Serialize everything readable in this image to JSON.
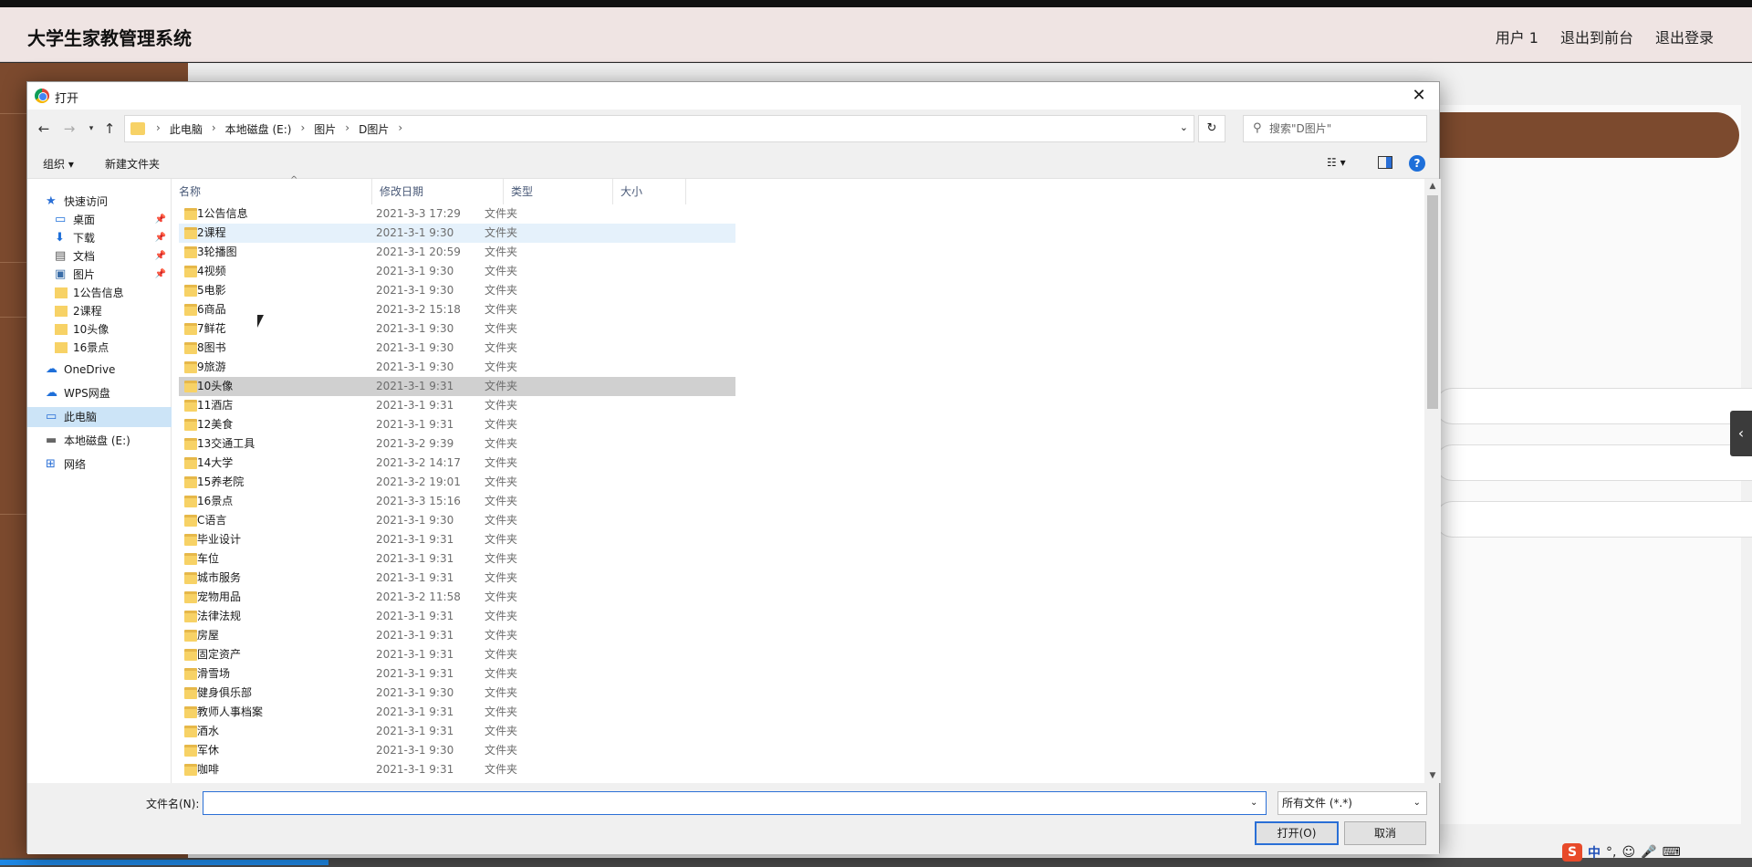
{
  "app": {
    "title": "大学生家教管理系统",
    "nav": [
      "用户 1",
      "退出到前台",
      "退出登录"
    ]
  },
  "dialog": {
    "title": "打开",
    "breadcrumb": [
      "此电脑",
      "本地磁盘 (E:)",
      "图片",
      "D图片"
    ],
    "search_placeholder": "搜索\"D图片\"",
    "toolbar": {
      "organize": "组织 ▾",
      "new_folder": "新建文件夹"
    },
    "nav_pane": [
      {
        "label": "快速访问",
        "icon": "star-icon",
        "pinned": false
      },
      {
        "label": "桌面",
        "icon": "desktop-icon",
        "pinned": true
      },
      {
        "label": "下载",
        "icon": "download-icon",
        "pinned": true
      },
      {
        "label": "文档",
        "icon": "document-icon",
        "pinned": true
      },
      {
        "label": "图片",
        "icon": "pictures-icon",
        "pinned": true
      },
      {
        "label": "1公告信息",
        "icon": "folder-icon",
        "pinned": false
      },
      {
        "label": "2课程",
        "icon": "folder-icon",
        "pinned": false
      },
      {
        "label": "10头像",
        "icon": "folder-icon",
        "pinned": false
      },
      {
        "label": "16景点",
        "icon": "folder-icon",
        "pinned": false
      },
      {
        "label": "OneDrive",
        "icon": "cloud-icon",
        "pinned": false
      },
      {
        "label": "WPS网盘",
        "icon": "cloud-icon",
        "pinned": false
      },
      {
        "label": "此电脑",
        "icon": "computer-icon",
        "pinned": false
      },
      {
        "label": "本地磁盘 (E:)",
        "icon": "drive-icon",
        "pinned": false
      },
      {
        "label": "网络",
        "icon": "network-icon",
        "pinned": false
      }
    ],
    "columns": [
      "名称",
      "修改日期",
      "类型",
      "大小"
    ],
    "files": [
      {
        "name": "1公告信息",
        "date": "2021-3-3 17:29",
        "type": "文件夹"
      },
      {
        "name": "2课程",
        "date": "2021-3-1 9:30",
        "type": "文件夹"
      },
      {
        "name": "3轮播图",
        "date": "2021-3-1 20:59",
        "type": "文件夹"
      },
      {
        "name": "4视频",
        "date": "2021-3-1 9:30",
        "type": "文件夹"
      },
      {
        "name": "5电影",
        "date": "2021-3-1 9:30",
        "type": "文件夹"
      },
      {
        "name": "6商品",
        "date": "2021-3-2 15:18",
        "type": "文件夹"
      },
      {
        "name": "7鲜花",
        "date": "2021-3-1 9:30",
        "type": "文件夹"
      },
      {
        "name": "8图书",
        "date": "2021-3-1 9:30",
        "type": "文件夹"
      },
      {
        "name": "9旅游",
        "date": "2021-3-1 9:30",
        "type": "文件夹"
      },
      {
        "name": "10头像",
        "date": "2021-3-1 9:31",
        "type": "文件夹"
      },
      {
        "name": "11酒店",
        "date": "2021-3-1 9:31",
        "type": "文件夹"
      },
      {
        "name": "12美食",
        "date": "2021-3-1 9:31",
        "type": "文件夹"
      },
      {
        "name": "13交通工具",
        "date": "2021-3-2 9:39",
        "type": "文件夹"
      },
      {
        "name": "14大学",
        "date": "2021-3-2 14:17",
        "type": "文件夹"
      },
      {
        "name": "15养老院",
        "date": "2021-3-2 19:01",
        "type": "文件夹"
      },
      {
        "name": "16景点",
        "date": "2021-3-3 15:16",
        "type": "文件夹"
      },
      {
        "name": "C语言",
        "date": "2021-3-1 9:30",
        "type": "文件夹"
      },
      {
        "name": "毕业设计",
        "date": "2021-3-1 9:31",
        "type": "文件夹"
      },
      {
        "name": "车位",
        "date": "2021-3-1 9:31",
        "type": "文件夹"
      },
      {
        "name": "城市服务",
        "date": "2021-3-1 9:31",
        "type": "文件夹"
      },
      {
        "name": "宠物用品",
        "date": "2021-3-2 11:58",
        "type": "文件夹"
      },
      {
        "name": "法律法规",
        "date": "2021-3-1 9:31",
        "type": "文件夹"
      },
      {
        "name": "房屋",
        "date": "2021-3-1 9:31",
        "type": "文件夹"
      },
      {
        "name": "固定资产",
        "date": "2021-3-1 9:31",
        "type": "文件夹"
      },
      {
        "name": "滑雪场",
        "date": "2021-3-1 9:31",
        "type": "文件夹"
      },
      {
        "name": "健身俱乐部",
        "date": "2021-3-1 9:30",
        "type": "文件夹"
      },
      {
        "name": "教师人事档案",
        "date": "2021-3-1 9:31",
        "type": "文件夹"
      },
      {
        "name": "酒水",
        "date": "2021-3-1 9:31",
        "type": "文件夹"
      },
      {
        "name": "军休",
        "date": "2021-3-1 9:30",
        "type": "文件夹"
      },
      {
        "name": "咖啡",
        "date": "2021-3-1 9:31",
        "type": "文件夹"
      }
    ],
    "filename_label": "文件名(N):",
    "filename_value": "",
    "filter": "所有文件 (*.*)",
    "open_button": "打开(O)",
    "cancel_button": "取消"
  },
  "tray": {
    "ime": "中"
  }
}
